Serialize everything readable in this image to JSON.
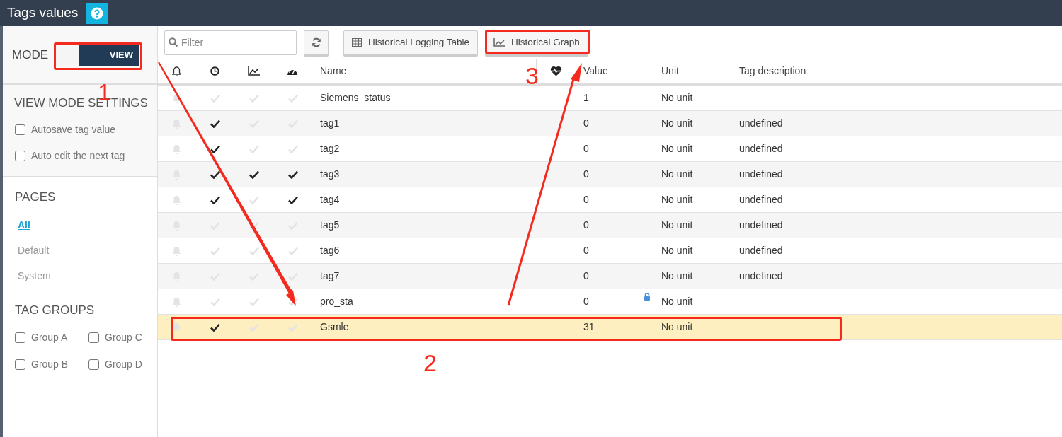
{
  "header": {
    "title": "Tags values"
  },
  "sidebar": {
    "mode": {
      "label": "MODE",
      "toggle_text": "VIEW",
      "on": true
    },
    "view_mode_settings": {
      "title": "VIEW MODE SETTINGS",
      "options": [
        {
          "label": "Autosave tag value",
          "checked": false
        },
        {
          "label": "Auto edit the next tag",
          "checked": false
        }
      ]
    },
    "pages": {
      "title": "PAGES",
      "items": [
        {
          "label": "All",
          "selected": true
        },
        {
          "label": "Default",
          "selected": false
        },
        {
          "label": "System",
          "selected": false
        }
      ]
    },
    "tag_groups": {
      "title": "TAG GROUPS",
      "items": [
        {
          "label": "Group A",
          "checked": false
        },
        {
          "label": "Group C",
          "checked": false
        },
        {
          "label": "Group B",
          "checked": false
        },
        {
          "label": "Group D",
          "checked": false
        }
      ]
    }
  },
  "toolbar": {
    "filter": {
      "placeholder": "Filter"
    },
    "buttons": [
      {
        "kind": "table",
        "label": "Historical Logging Table"
      },
      {
        "kind": "graph",
        "label": "Historical Graph"
      }
    ]
  },
  "table": {
    "columns": [
      {
        "kind": "alarm"
      },
      {
        "kind": "logging"
      },
      {
        "kind": "graph"
      },
      {
        "kind": "dashboard"
      },
      {
        "kind": "text",
        "label": "Name"
      },
      {
        "kind": "status"
      },
      {
        "kind": "text",
        "label": "Value"
      },
      {
        "kind": "text",
        "label": "Unit"
      },
      {
        "kind": "text",
        "label": "Tag description"
      }
    ],
    "rows": [
      {
        "name": "Siemens_status",
        "logging": false,
        "graph": false,
        "dashboard": false,
        "value": "1",
        "locked": false,
        "unit": "No unit",
        "selected": false
      },
      {
        "name": "tag1",
        "logging": true,
        "graph": false,
        "dashboard": false,
        "value": "0",
        "locked": false,
        "unit": "No unit",
        "description": "undefined",
        "selected": false
      },
      {
        "name": "tag2",
        "logging": true,
        "graph": false,
        "dashboard": false,
        "value": "0",
        "locked": false,
        "unit": "No unit",
        "description": "undefined",
        "selected": false
      },
      {
        "name": "tag3",
        "logging": true,
        "graph": true,
        "dashboard": true,
        "value": "0",
        "locked": false,
        "unit": "No unit",
        "description": "undefined",
        "selected": false
      },
      {
        "name": "tag4",
        "logging": true,
        "graph": false,
        "dashboard": true,
        "value": "0",
        "locked": false,
        "unit": "No unit",
        "description": "undefined",
        "selected": false
      },
      {
        "name": "tag5",
        "logging": false,
        "graph": false,
        "dashboard": false,
        "value": "0",
        "locked": false,
        "unit": "No unit",
        "description": "undefined",
        "selected": false
      },
      {
        "name": "tag6",
        "logging": false,
        "graph": false,
        "dashboard": false,
        "value": "0",
        "locked": false,
        "unit": "No unit",
        "description": "undefined",
        "selected": false
      },
      {
        "name": "tag7",
        "logging": false,
        "graph": false,
        "dashboard": false,
        "value": "0",
        "locked": false,
        "unit": "No unit",
        "description": "undefined",
        "selected": false
      },
      {
        "name": "pro_sta",
        "logging": false,
        "graph": false,
        "dashboard": false,
        "value": "0",
        "locked": true,
        "unit": "No unit",
        "selected": false
      },
      {
        "name": "Gsmle",
        "logging": true,
        "graph": false,
        "dashboard": false,
        "value": "31",
        "locked": false,
        "unit": "No unit",
        "selected": true
      }
    ]
  },
  "annotations": [
    {
      "label": "1"
    },
    {
      "label": "2"
    },
    {
      "label": "3"
    }
  ]
}
